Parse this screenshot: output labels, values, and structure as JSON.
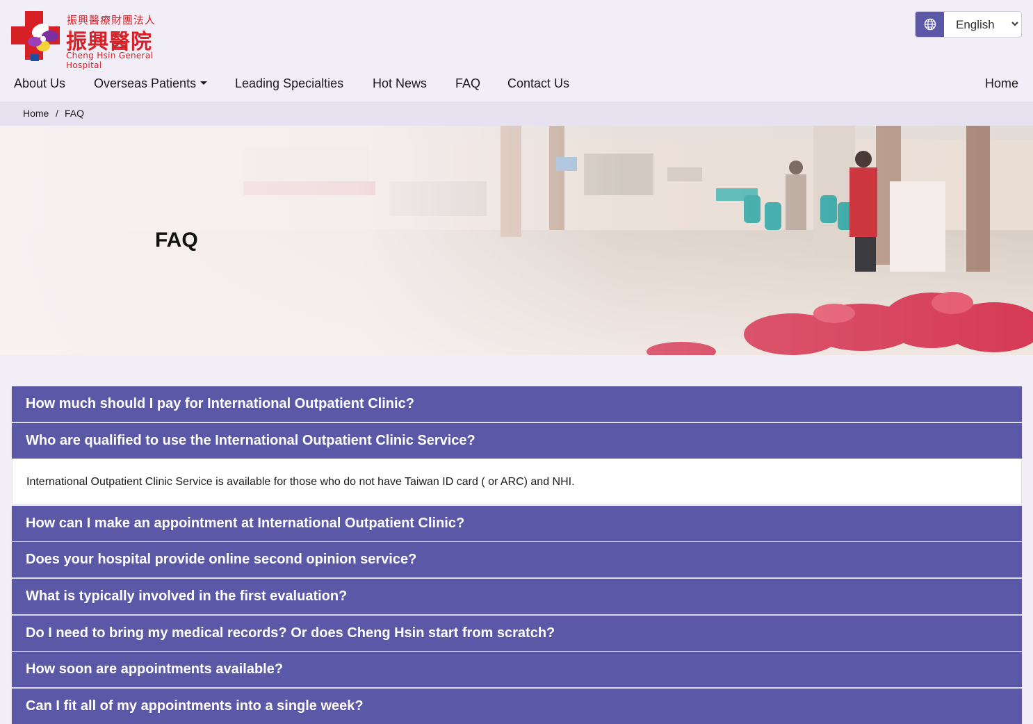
{
  "header": {
    "logo": {
      "org_name_small": "振興醫療財團法人",
      "hospital_name_zh": "振興醫院",
      "hospital_name_en": "Cheng Hsin General Hospital"
    },
    "language": {
      "icon": "globe-icon",
      "selected": "English"
    },
    "nav": {
      "about_us": "About Us",
      "overseas_patients": "Overseas Patients",
      "leading_specialties": "Leading Specialties",
      "hot_news": "Hot News",
      "faq": "FAQ",
      "contact_us": "Contact Us",
      "home": "Home"
    }
  },
  "breadcrumb": {
    "home": "Home",
    "separator": "/",
    "current": "FAQ"
  },
  "hero": {
    "title": "FAQ"
  },
  "faq": {
    "items": [
      {
        "question": "How much should I pay for International Outpatient Clinic?"
      },
      {
        "question": "Who are qualified to use the International Outpatient Clinic Service?",
        "answer": "International Outpatient Clinic Service is available for those who do not have Taiwan ID card ( or ARC) and NHI."
      },
      {
        "question": "How can I make an appointment at International Outpatient Clinic?"
      },
      {
        "question": "Does your hospital provide online second opinion service?"
      },
      {
        "question": "What is typically involved in the first evaluation?"
      },
      {
        "question": "Do I need to bring my medical records? Or does Cheng Hsin start from scratch?"
      },
      {
        "question": "How soon are appointments available?"
      },
      {
        "question": "Can I fit all of my appointments into a single week?"
      }
    ]
  },
  "colors": {
    "accent": "#5b58a8",
    "brand_red": "#d71f26",
    "page_bg": "#f1eef8"
  }
}
